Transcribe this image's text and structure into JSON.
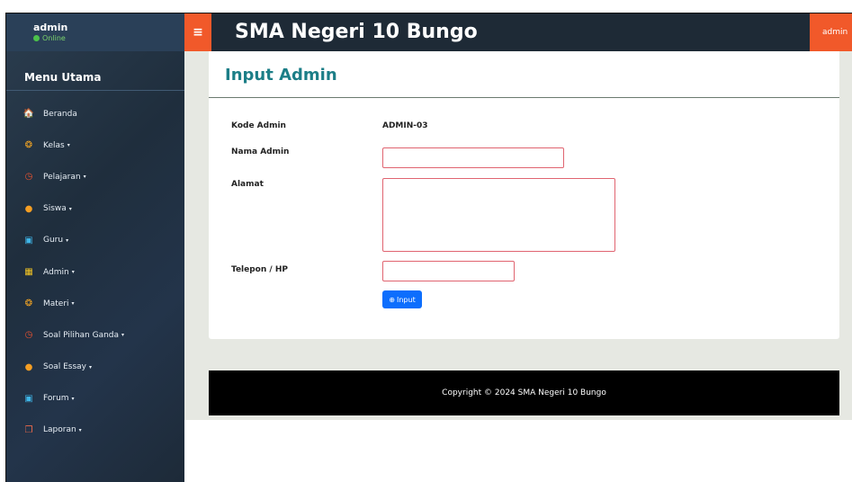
{
  "sidebar": {
    "user": {
      "name": "admin",
      "status": "Online"
    },
    "header": "Menu Utama",
    "items": [
      {
        "label": "Beranda",
        "icon": "home-icon",
        "glyph": "🏠",
        "color": "#ffffff",
        "caret": ""
      },
      {
        "label": "Kelas",
        "icon": "kelas-icon",
        "glyph": "❂",
        "color": "#f5a623",
        "caret": "▾"
      },
      {
        "label": "Pelajaran",
        "icon": "clock-icon",
        "glyph": "◷",
        "color": "#f0532e",
        "caret": "▾"
      },
      {
        "label": "Siswa",
        "icon": "users-icon",
        "glyph": "●",
        "color": "#f59e23",
        "caret": "▾"
      },
      {
        "label": "Guru",
        "icon": "teacher-icon",
        "glyph": "▣",
        "color": "#3fb6e8",
        "caret": "▾"
      },
      {
        "label": "Admin",
        "icon": "table-icon",
        "glyph": "▦",
        "color": "#f5c623",
        "caret": "▾"
      },
      {
        "label": "Materi",
        "icon": "materi-icon",
        "glyph": "❂",
        "color": "#f5a623",
        "caret": "▾"
      },
      {
        "label": "Soal Pilihan Ganda",
        "icon": "clock-icon",
        "glyph": "◷",
        "color": "#f0532e",
        "caret": "▾"
      },
      {
        "label": "Soal Essay",
        "icon": "users-icon",
        "glyph": "●",
        "color": "#f59e23",
        "caret": "▾"
      },
      {
        "label": "Forum",
        "icon": "forum-icon",
        "glyph": "▣",
        "color": "#3fb6e8",
        "caret": "▾"
      },
      {
        "label": "Laporan",
        "icon": "copy-icon",
        "glyph": "❐",
        "color": "#f06a4a",
        "caret": "▾"
      }
    ]
  },
  "topbar": {
    "menu_glyph": "≡",
    "title": "SMA Negeri 10 Bungo",
    "user_label": "admin",
    "user_caret": "⌄"
  },
  "form": {
    "title": "Input Admin",
    "kode_label": "Kode Admin",
    "kode_value": "ADMIN-03",
    "nama_label": "Nama Admin",
    "nama_value": "",
    "alamat_label": "Alamat",
    "alamat_value": "",
    "telepon_label": "Telepon / HP",
    "telepon_value": "",
    "submit_label": "Input",
    "submit_glyph": "⊕"
  },
  "footer": {
    "text": "Copyright © 2024 SMA Negeri 10 Bungo"
  },
  "colors": {
    "accent": "#f1592a",
    "title_teal": "#1c7e87",
    "button_blue": "#0d6efd",
    "sidebar_dark": "#1f2e3d"
  }
}
